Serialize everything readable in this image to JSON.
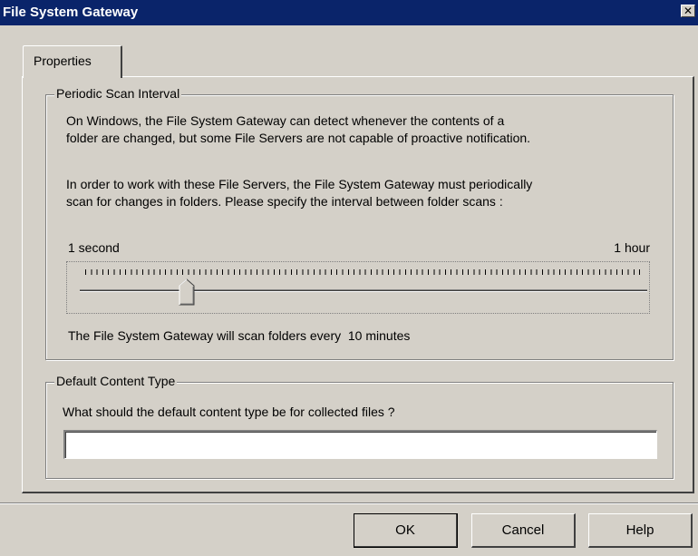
{
  "window": {
    "title": "File System Gateway",
    "close_label": "✕"
  },
  "tabs": [
    {
      "label": "Properties",
      "active": true
    }
  ],
  "scan_group": {
    "label": "Periodic Scan Interval",
    "desc1_line1": "On Windows, the File System Gateway can detect whenever the contents of a",
    "desc1_line2": "folder are changed, but some File Servers are not capable of proactive notification.",
    "desc2_line1": "In order to work with these File Servers, the File System Gateway must periodically",
    "desc2_line2": "scan for changes in folders. Please specify the interval between folder scans :",
    "slider_min_label": "1 second",
    "slider_max_label": "1 hour",
    "slider_value_fraction": 0.18,
    "status": "The File System Gateway will scan folders every  10 minutes"
  },
  "content_group": {
    "label": "Default Content Type",
    "prompt": "What should the default content type be for collected files ?",
    "input_value": "",
    "input_placeholder": ""
  },
  "buttons": {
    "ok": "OK",
    "cancel": "Cancel",
    "help": "Help"
  },
  "colors": {
    "titlebar": "#0a246a",
    "face": "#d4d0c8"
  }
}
